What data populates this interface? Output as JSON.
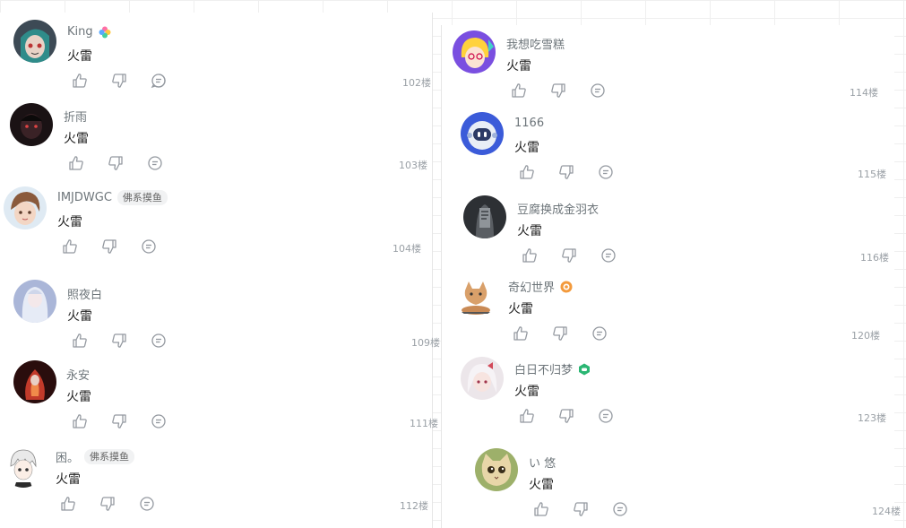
{
  "left": [
    {
      "user": "King",
      "badge": "",
      "icon": "colorful-flower-icon",
      "text": "火雷",
      "floor": "102楼"
    },
    {
      "user": "折雨",
      "badge": "",
      "icon": "",
      "text": "火雷",
      "floor": "103楼"
    },
    {
      "user": "IMJDWGC",
      "badge": "佛系摸鱼",
      "icon": "",
      "text": "火雷",
      "floor": "104楼"
    },
    {
      "user": "照夜白",
      "badge": "",
      "icon": "",
      "text": "火雷",
      "floor": "109楼"
    },
    {
      "user": "永安",
      "badge": "",
      "icon": "",
      "text": "火雷",
      "floor": "111楼"
    },
    {
      "user": "困。",
      "badge": "佛系摸鱼",
      "icon": "",
      "text": "火雷",
      "floor": "112楼"
    }
  ],
  "right": [
    {
      "user": "我想吃雪糕",
      "badge": "",
      "icon": "",
      "text": "火雷",
      "floor": "114楼"
    },
    {
      "user": "1166",
      "badge": "",
      "icon": "",
      "text": "火雷",
      "floor": "115楼"
    },
    {
      "user": "豆腐换成金羽衣",
      "badge": "",
      "icon": "",
      "text": "火雷",
      "floor": "116楼"
    },
    {
      "user": "奇幻世界",
      "badge": "",
      "icon": "orange-badge-icon",
      "text": "火雷",
      "floor": "120楼"
    },
    {
      "user": "白日不归梦",
      "badge": "",
      "icon": "green-game-icon",
      "text": "火雷",
      "floor": "123楼"
    },
    {
      "user": "い 悠",
      "badge": "",
      "icon": "",
      "text": "火雷",
      "floor": "124楼"
    }
  ],
  "colors": {
    "username": "#6d757a",
    "floor": "#9aa0a6",
    "icon": "#9499a0"
  }
}
